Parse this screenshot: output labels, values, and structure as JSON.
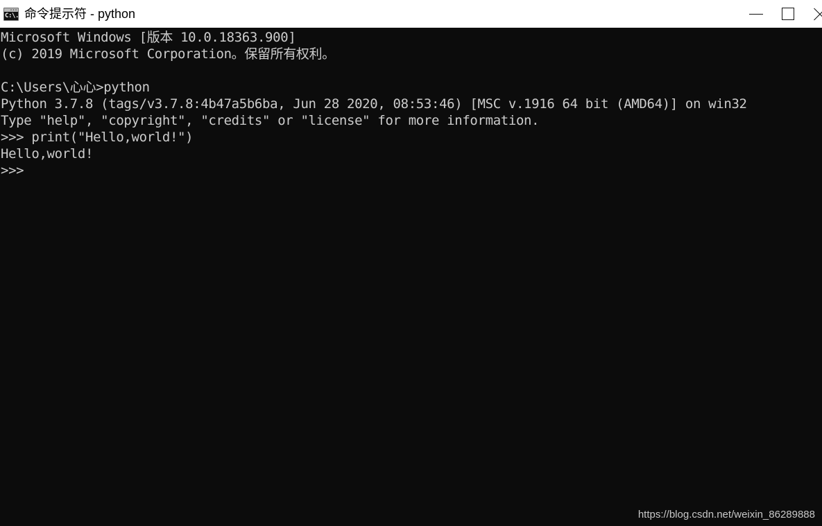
{
  "window": {
    "title": "命令提示符 - python",
    "icon_name": "cmd-prompt-icon",
    "icon_glyph": "C:\\.",
    "titlebar_bg": "#ffffff",
    "console_bg": "#0c0c0c",
    "console_fg": "#cccccc"
  },
  "controls": {
    "minimize_label": "最小化",
    "maximize_label": "最大化",
    "close_label": "关闭"
  },
  "console": {
    "lines": [
      "Microsoft Windows [版本 10.0.18363.900]",
      "(c) 2019 Microsoft Corporation。保留所有权利。",
      "",
      "C:\\Users\\心心>python",
      "Python 3.7.8 (tags/v3.7.8:4b47a5b6ba, Jun 28 2020, 08:53:46) [MSC v.1916 64 bit (AMD64)] on win32",
      "Type \"help\", \"copyright\", \"credits\" or \"license\" for more information.",
      ">>> print(\"Hello,world!\")",
      "Hello,world!",
      ">>>"
    ]
  },
  "watermark": {
    "text": "https://blog.csdn.net/weixin_86289888"
  }
}
